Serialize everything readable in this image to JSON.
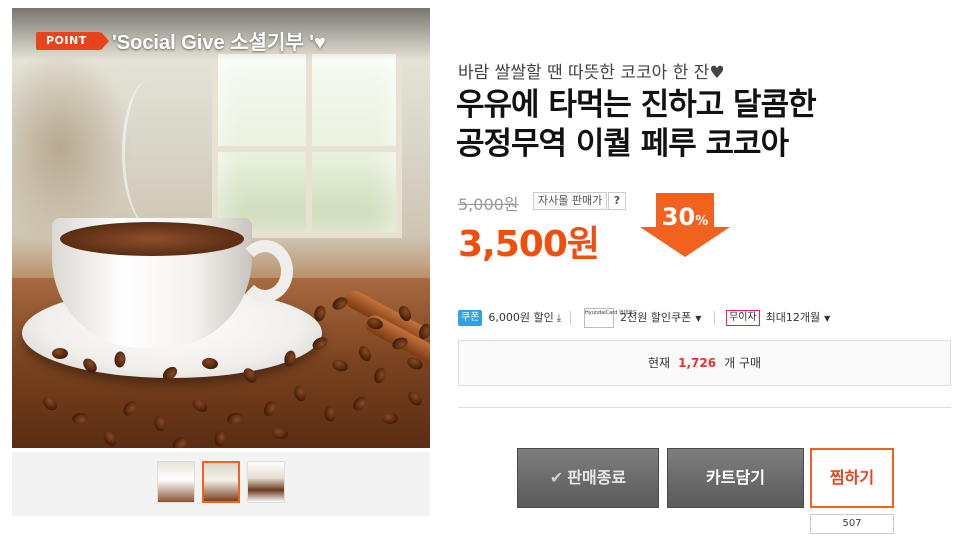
{
  "hero": {
    "badge": "POINT",
    "caption": "'Social Give 소셜기부 '♥"
  },
  "thumbnails": [
    {
      "label": "coffee cup thumbnail 1"
    },
    {
      "label": "coffee cup thumbnail 2",
      "active": true
    },
    {
      "label": "product package thumbnail"
    }
  ],
  "product": {
    "subtitle": "바람 쌀쌀할 땐 따뜻한 코코아 한 잔♥",
    "title_line1": "우유에 타먹는 진하고 달콤한",
    "title_line2": "공정무역 이퀄 페루 코코아",
    "original_price": "5,000원",
    "seller_tag": "자사몰 판매가",
    "help": "?",
    "sale_price": "3,500원",
    "discount_value": "30",
    "discount_unit": "%"
  },
  "benefits": {
    "coupon_chip": "쿠폰",
    "coupon_text": "6,000원 할인",
    "card_chip": "HyundaiCard 현대카드",
    "card_text": "2천원 할인쿠폰",
    "installment_chip": "무이자",
    "installment_text": "최대12개월"
  },
  "purchase": {
    "prefix": "현재",
    "count": "1,726",
    "suffix": "개 구매"
  },
  "actions": {
    "sold_out": "판매종료",
    "cart": "카트담기",
    "wish": "찜하기",
    "wish_count": "507"
  },
  "colors": {
    "accent": "#f0621e",
    "price": "#f04e0c",
    "count": "#e8322c",
    "coupon": "#2fa3e6"
  }
}
